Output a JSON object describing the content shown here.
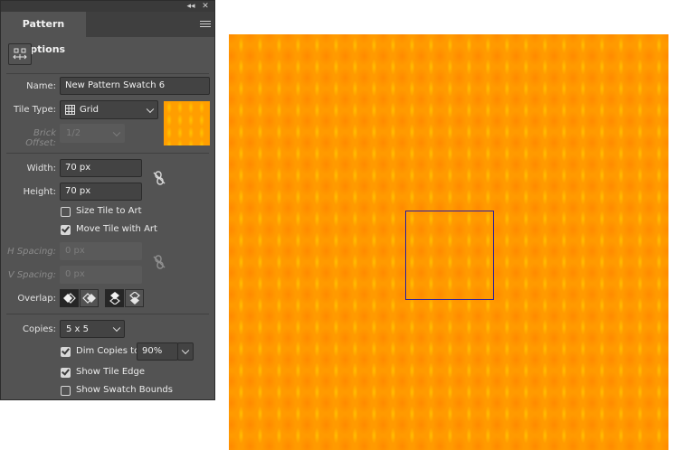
{
  "panel": {
    "title": "Pattern Options",
    "name_label": "Name:",
    "name_value": "New Pattern Swatch 6",
    "tile_type_label": "Tile Type:",
    "tile_type_value": "Grid",
    "brick_offset_label": "Brick Offset:",
    "brick_offset_value": "1/2",
    "width_label": "Width:",
    "width_value": "70 px",
    "height_label": "Height:",
    "height_value": "70 px",
    "size_tile_label": "Size Tile to Art",
    "size_tile_checked": false,
    "move_tile_label": "Move Tile with Art",
    "move_tile_checked": true,
    "h_spacing_label": "H Spacing:",
    "h_spacing_value": "0 px",
    "v_spacing_label": "V Spacing:",
    "v_spacing_value": "0 px",
    "overlap_label": "Overlap:",
    "copies_label": "Copies:",
    "copies_value": "5 x 5",
    "dim_copies_label": "Dim Copies to:",
    "dim_copies_checked": true,
    "dim_copies_value": "90%",
    "show_tile_edge_label": "Show Tile Edge",
    "show_tile_edge_checked": true,
    "show_swatch_bounds_label": "Show Swatch Bounds",
    "show_swatch_bounds_checked": false
  },
  "icons": {
    "collapse": "double-chevron-left-icon",
    "close": "close-icon",
    "menu": "hamburger-menu-icon",
    "tile_tool": "pattern-tile-tool-icon",
    "grid": "grid-icon",
    "link": "link-icon"
  },
  "colors": {
    "panel_bg": "#535353",
    "pattern_base": "#ff9a00",
    "pattern_highlight": "#ffc000",
    "tile_edge": "#2b1f9e"
  }
}
